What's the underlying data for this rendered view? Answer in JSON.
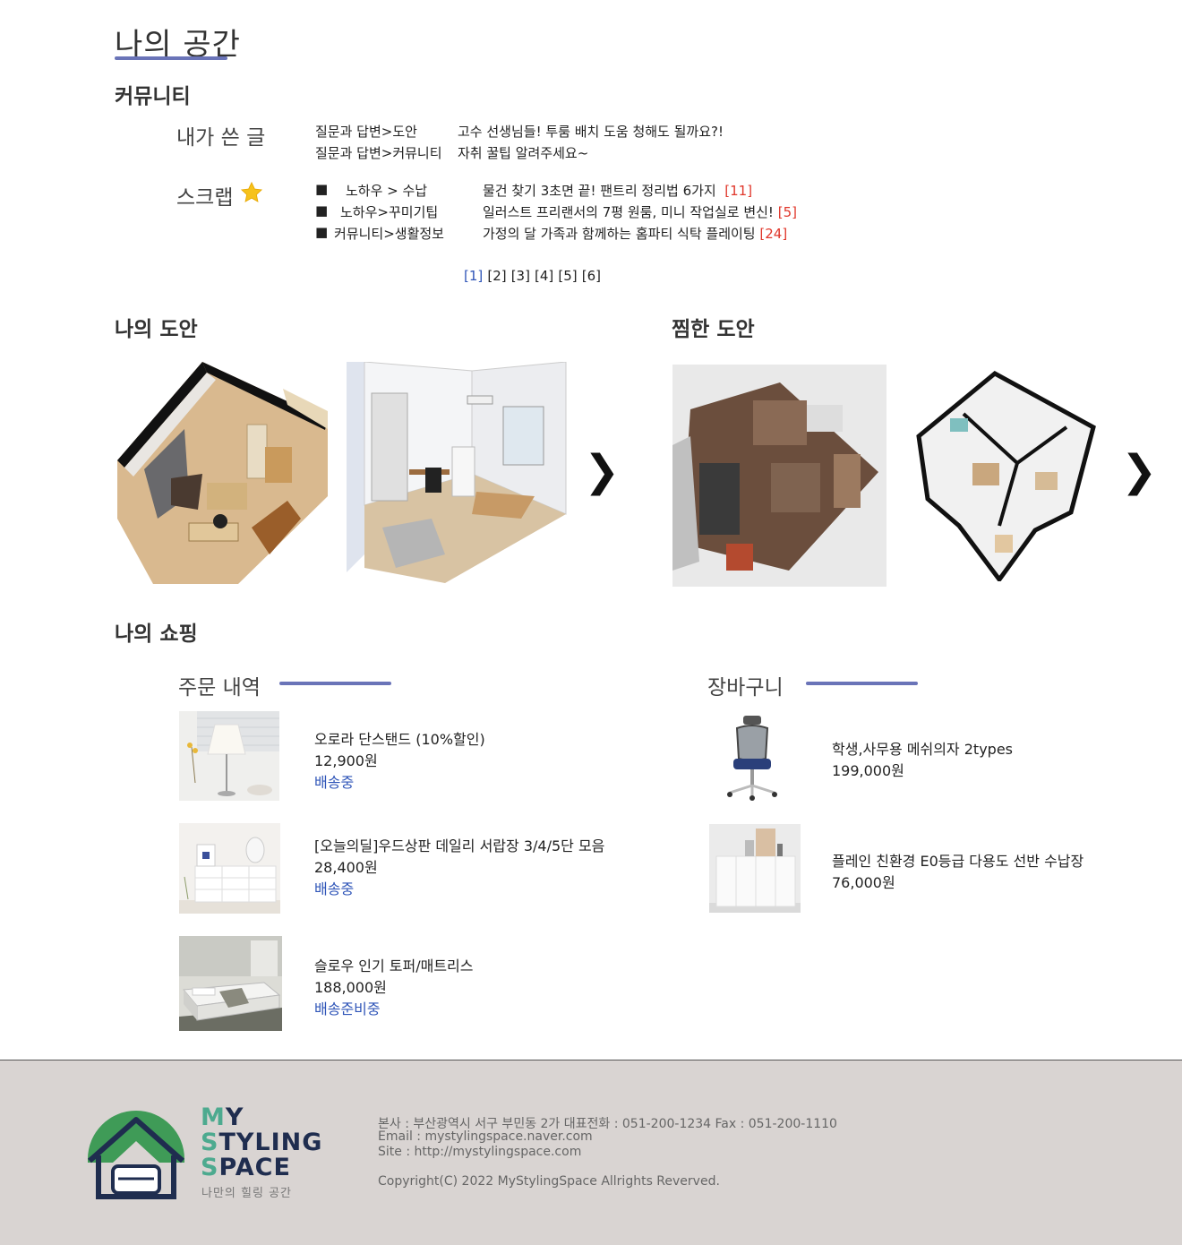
{
  "page": {
    "title": "나의 공간"
  },
  "community": {
    "heading": "커뮤니티",
    "my_posts": {
      "label": "내가 쓴 글",
      "items": [
        {
          "category": "질문과 답변>도안",
          "title": "고수 선생님들! 투룸 배치 도움 청해도 될까요?!"
        },
        {
          "category": "질문과 답변>커뮤니티",
          "title": "자취 꿀팁 알려주세요~"
        }
      ]
    },
    "scrap": {
      "label": "스크랩",
      "items": [
        {
          "bullet": "■",
          "category": "노하우 > 수납",
          "title": "물건 찾기 3초면 끝! 팬트리 정리법 6가지",
          "count": "[11]"
        },
        {
          "bullet": "■",
          "category": "노하우>꾸미기팁",
          "title": "일러스트 프리랜서의 7평 원룸, 미니 작업실로 변신!",
          "count": "[5]"
        },
        {
          "bullet": "■",
          "category": "커뮤니티>생활정보",
          "title": "가정의 달 가족과 함께하는 홈파티 식탁 플레이팅",
          "count": "[24]"
        }
      ]
    },
    "pagination": [
      "[1]",
      "[2]",
      "[3]",
      "[4]",
      "[5]",
      "[6]"
    ]
  },
  "my_designs": {
    "heading": "나의 도안",
    "next_arrow": "❯"
  },
  "liked_designs": {
    "heading": "찜한 도안",
    "next_arrow": "❯"
  },
  "shopping": {
    "heading": "나의 쇼핑",
    "orders": {
      "heading": "주문 내역",
      "items": [
        {
          "name": "오로라 단스탠드 (10%할인)",
          "price": "12,900원",
          "status": "배송중"
        },
        {
          "name": "[오늘의딜]우드상판 데일리 서랍장 3/4/5단 모음",
          "price": "28,400원",
          "status": "배송중"
        },
        {
          "name": "슬로우 인기 토퍼/매트리스",
          "price": "188,000원",
          "status": "배송준비중"
        }
      ]
    },
    "cart": {
      "heading": "장바구니",
      "items": [
        {
          "name": "학생,사무용 메쉬의자 2types",
          "price": "199,000원"
        },
        {
          "name": "플레인 친환경 E0등급 다용도 선반 수납장",
          "price": "76,000원"
        }
      ]
    }
  },
  "footer": {
    "logo_line1": {
      "a": "M",
      "b": "Y"
    },
    "logo_line2": {
      "a": "S",
      "b": "TYLING"
    },
    "logo_line3": {
      "a": "S",
      "b": "PACE"
    },
    "tagline": "나만의 힐링 공간",
    "address": "본사 : 부산광역시 서구 부민동 2가  대표전화 : 051-200-1234 Fax : 051-200-1110",
    "email": "Email : mystylingspace.naver.com",
    "site": "Site : http://mystylingspace.com",
    "copyright": "Copyright(C) 2022 MyStylingSpace Allrights Reverved."
  },
  "colors": {
    "accent": "#6a74b8",
    "link": "#2f55b8",
    "count": "#e0362a",
    "footer_bg": "#d9d4d2"
  }
}
